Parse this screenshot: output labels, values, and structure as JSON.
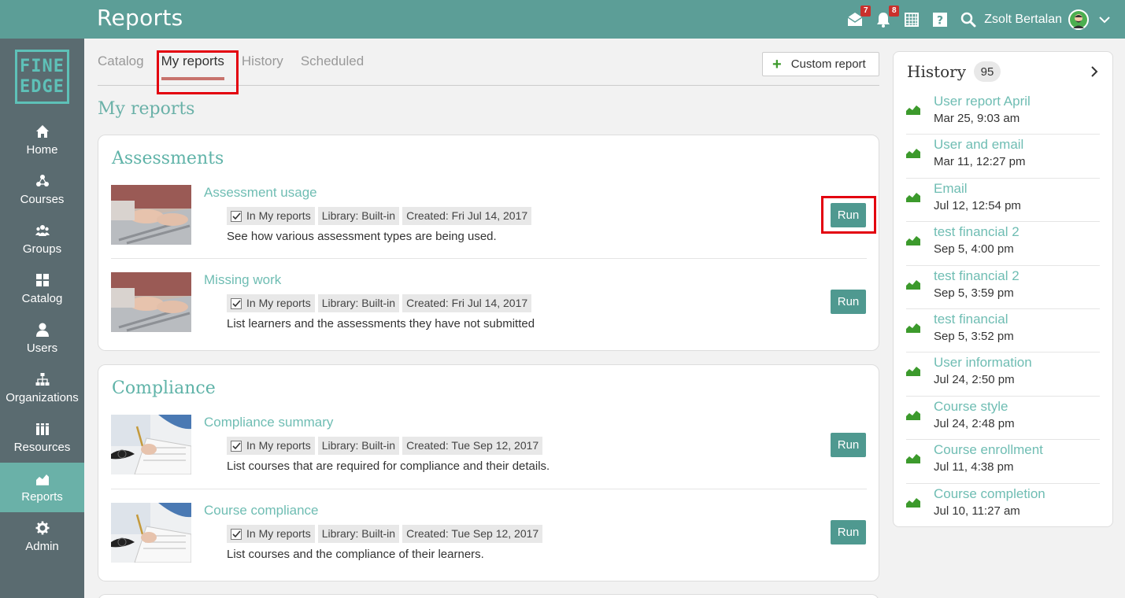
{
  "header": {
    "title": "Reports",
    "messages_badge": "7",
    "notifications_badge": "8",
    "user_name": "Zsolt Bertalan"
  },
  "logo": {
    "line1": "FINE",
    "line2": "EDGE"
  },
  "sidebar": {
    "items": [
      {
        "label": "Home",
        "icon": "home-icon"
      },
      {
        "label": "Courses",
        "icon": "courses-icon"
      },
      {
        "label": "Groups",
        "icon": "groups-icon"
      },
      {
        "label": "Catalog",
        "icon": "catalog-icon"
      },
      {
        "label": "Users",
        "icon": "user-icon"
      },
      {
        "label": "Organizations",
        "icon": "organizations-icon"
      },
      {
        "label": "Resources",
        "icon": "resources-icon"
      },
      {
        "label": "Reports",
        "icon": "reports-icon",
        "active": true
      },
      {
        "label": "Admin",
        "icon": "gear-icon"
      }
    ]
  },
  "tabs": [
    {
      "label": "Catalog"
    },
    {
      "label": "My reports",
      "active": true
    },
    {
      "label": "History"
    },
    {
      "label": "Scheduled"
    }
  ],
  "custom_report_label": "Custom report",
  "main": {
    "heading": "My reports",
    "sections": [
      {
        "title": "Assessments",
        "reports": [
          {
            "title": "Assessment usage",
            "in_my_reports": "In My reports",
            "library": "Library: Built-in",
            "created": "Created: Fri Jul 14, 2017",
            "description": "See how various assessment types are being used.",
            "run": "Run"
          },
          {
            "title": "Missing work",
            "in_my_reports": "In My reports",
            "library": "Library: Built-in",
            "created": "Created: Fri Jul 14, 2017",
            "description": "List learners and the assessments they have not submitted",
            "run": "Run"
          }
        ]
      },
      {
        "title": "Compliance",
        "reports": [
          {
            "title": "Compliance summary",
            "in_my_reports": "In My reports",
            "library": "Library: Built-in",
            "created": "Created: Tue Sep 12, 2017",
            "description": "List courses that are required for compliance and their details.",
            "run": "Run"
          },
          {
            "title": "Course compliance",
            "in_my_reports": "In My reports",
            "library": "Library: Built-in",
            "created": "Created: Tue Sep 12, 2017",
            "description": "List courses and the compliance of their learners.",
            "run": "Run"
          }
        ]
      }
    ]
  },
  "history": {
    "title": "History",
    "count": "95",
    "items": [
      {
        "title": "User report April",
        "date": "Mar 25, 9:03 am"
      },
      {
        "title": "User and email",
        "date": "Mar 11, 12:27 pm"
      },
      {
        "title": "Email",
        "date": "Jul 12, 12:54 pm"
      },
      {
        "title": "test financial 2",
        "date": "Sep 5, 4:00 pm"
      },
      {
        "title": "test financial 2",
        "date": "Sep 5, 3:59 pm"
      },
      {
        "title": "test financial",
        "date": "Sep 5, 3:52 pm"
      },
      {
        "title": "User information",
        "date": "Jul 24, 2:50 pm"
      },
      {
        "title": "Course style",
        "date": "Jul 24, 2:48 pm"
      },
      {
        "title": "Course enrollment",
        "date": "Jul 11, 4:38 pm"
      },
      {
        "title": "Course completion",
        "date": "Jul 10, 11:27 am"
      }
    ]
  },
  "colors": {
    "topbar": "#5c9e97",
    "sidebar": "#5a6b70",
    "accent": "#6ab1a8",
    "run_button": "#4f9990",
    "highlight": "#e3000f"
  }
}
